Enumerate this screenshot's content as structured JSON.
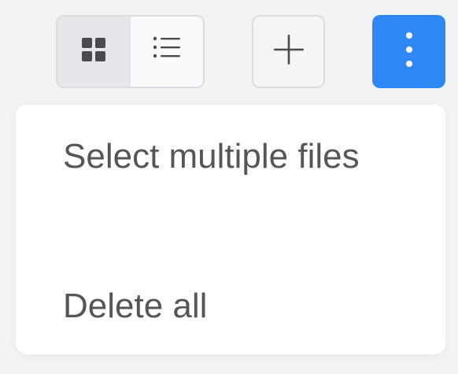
{
  "toolbar": {
    "view_modes": [
      {
        "name": "grid",
        "icon": "grid-icon",
        "active": true
      },
      {
        "name": "list",
        "icon": "list-icon",
        "active": false
      }
    ],
    "add_icon": "plus-icon",
    "more_icon": "vertical-ellipsis-icon"
  },
  "menu": {
    "items": [
      {
        "label": "Select multiple files"
      },
      {
        "label": "Delete all"
      }
    ]
  },
  "colors": {
    "accent": "#2f87f4",
    "menu_text": "#55565a",
    "icon": "#4a4b4f",
    "page_background": "#f2f3f5"
  }
}
